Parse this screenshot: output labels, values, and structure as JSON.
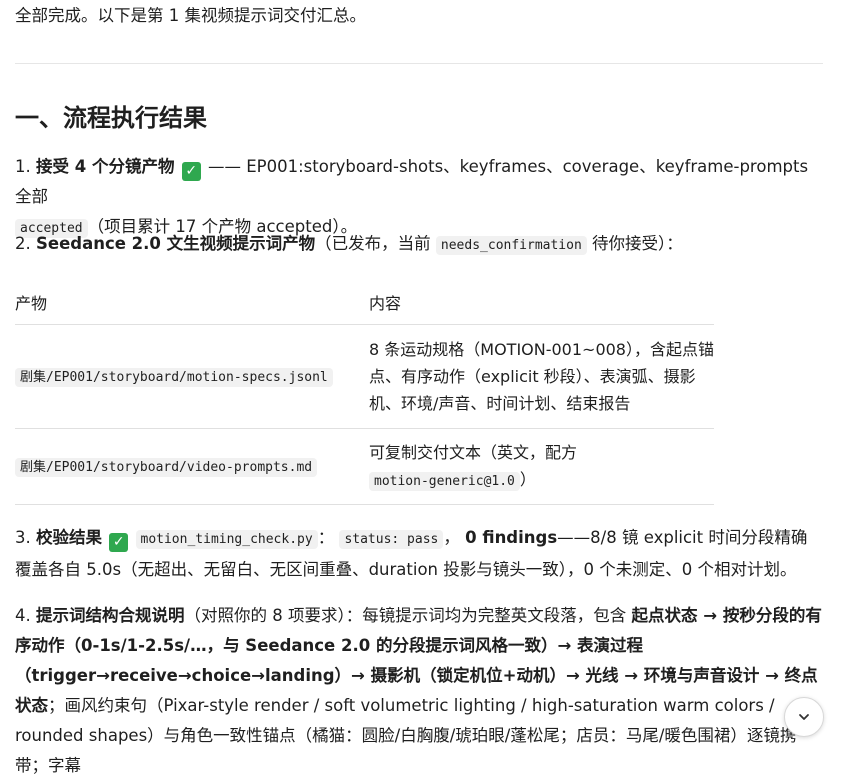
{
  "intro": "全部完成。以下是第 1 集视频提示词交付汇总。",
  "section_title": "一、流程执行结果",
  "item1": {
    "num": "1.",
    "bold": "接受 4 个分镜产物",
    "check": "✓",
    "text1": "—— EP001:storyboard-shots、keyframes、coverage、keyframe-prompts 全部",
    "code": "accepted",
    "text2": "（项目累计 17 个产物 accepted）。"
  },
  "item2": {
    "num": "2.",
    "bold": "Seedance 2.0 文生视频提示词产物",
    "text1": "（已发布，当前",
    "code": "needs_confirmation",
    "text2": "待你接受）："
  },
  "table": {
    "headers": [
      "产物",
      "内容"
    ],
    "rows": [
      {
        "file": "剧集/EP001/storyboard/motion-specs.jsonl",
        "content": "8 条运动规格（MOTION-001~008），含起点锚点、有序动作（explicit 秒段）、表演弧、摄影机、环境/声音、时间计划、结束报告"
      },
      {
        "file": "剧集/EP001/storyboard/video-prompts.md",
        "content_pre": "可复制交付文本（英文，配方",
        "content_code": "motion-generic@1.0",
        "content_post": "）"
      }
    ]
  },
  "item3": {
    "num": "3.",
    "bold": "校验结果",
    "check": "✓",
    "code1": "motion_timing_check.py",
    "sep": "：",
    "code2": "status: pass",
    "comma": "，",
    "bold2": "0 findings",
    "text": "——8/8 镜 explicit 时间分段精确覆盖各自 5.0s（无超出、无留白、无区间重叠、duration 投影与镜头一致），0 个未测定、0 个相对计划。"
  },
  "item4": {
    "num": "4.",
    "bold1": "提示词结构合规说明",
    "text1": "（对照你的 8 项要求）：每镜提示词均为完整英文段落，包含",
    "bold2": "起点状态 → 按秒分段的有序动作（0-1s/1-2.5s/…，与 Seedance 2.0 的分段提示词风格一致）→ 表演过程（trigger→receive→choice→landing）→ 摄影机（锁定机位+动机）→ 光线 → 环境与声音设计 → 终点状态",
    "text2": "；画风约束句（Pixar-style render / soft volumetric lighting / high-saturation warm colors / rounded shapes）与角色一致性锚点（橘猫：圆脸/白胸腹/琥珀眼/蓬松尾；店员：马尾/暖色围裙）逐镜携带；字幕"
  },
  "icons": {
    "scroll": "chevron-down-icon"
  }
}
